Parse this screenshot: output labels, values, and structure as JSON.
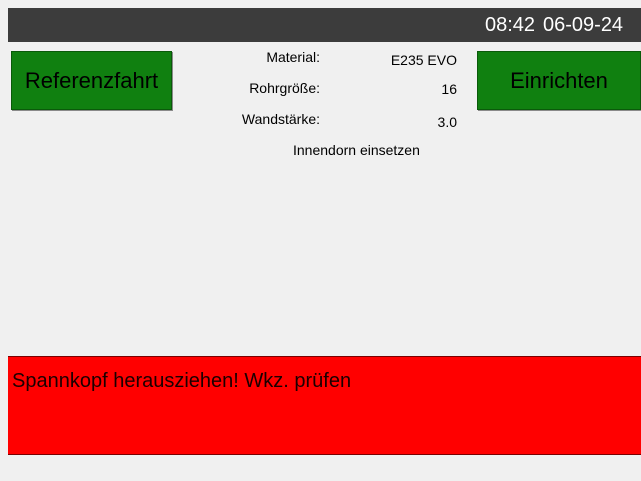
{
  "status_bar": {
    "time": "08:42",
    "date": "06-09-24"
  },
  "buttons": {
    "reference_run": "Referenzfahrt",
    "setup": "Einrichten"
  },
  "tube_info": {
    "material_label": "Material:",
    "material_value": "E235 EVO",
    "size_label": "Rohrgröße:",
    "size_value": "16",
    "wall_label": "Wandstärke:",
    "wall_value": "3.0",
    "instruction": "Innendorn einsetzen"
  },
  "alarm": {
    "message": "Spannkopf herausziehen! Wkz. prüfen",
    "color": "#ff0000"
  },
  "colors": {
    "button_green": "#108010",
    "topbar": "#3c3c3c",
    "background": "#f0f0f0"
  }
}
